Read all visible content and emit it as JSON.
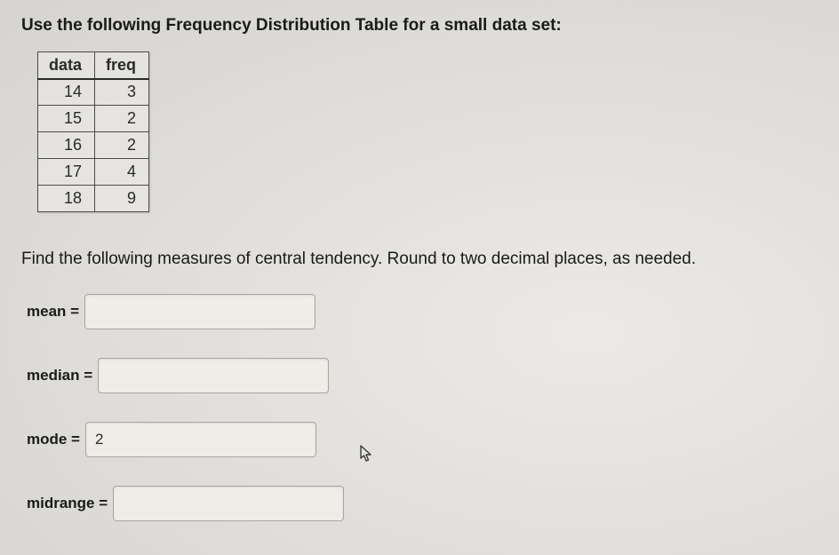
{
  "prompt": "Use the following Frequency Distribution Table for a small data set:",
  "table": {
    "headers": {
      "col1": "data",
      "col2": "freq"
    },
    "rows": [
      {
        "data": "14",
        "freq": "3"
      },
      {
        "data": "15",
        "freq": "2"
      },
      {
        "data": "16",
        "freq": "2"
      },
      {
        "data": "17",
        "freq": "4"
      },
      {
        "data": "18",
        "freq": "9"
      }
    ]
  },
  "instruction": "Find the following measures of central tendency. Round to two decimal places, as needed.",
  "answers": {
    "mean": {
      "label": "mean =",
      "value": ""
    },
    "median": {
      "label": "median =",
      "value": ""
    },
    "mode": {
      "label": "mode =",
      "value": "2"
    },
    "midrange": {
      "label": "midrange =",
      "value": ""
    }
  }
}
